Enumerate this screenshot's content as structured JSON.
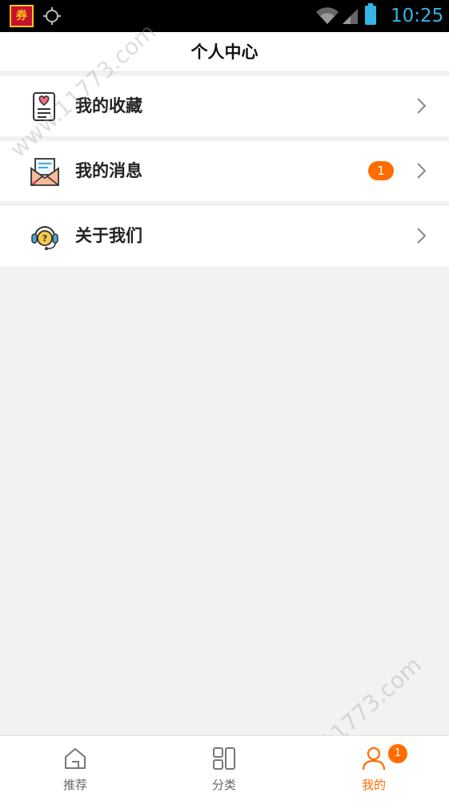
{
  "status_bar": {
    "app_icon_text": "券",
    "time": "10:25",
    "icons": [
      "app-notification-icon",
      "gps-icon",
      "wifi-icon",
      "signal-icon",
      "battery-icon"
    ]
  },
  "header": {
    "title": "个人中心"
  },
  "menu": {
    "items": [
      {
        "label": "我的收藏",
        "icon": "favorites-document-heart-icon"
      },
      {
        "label": "我的消息",
        "icon": "mail-envelope-icon",
        "badge": "1"
      },
      {
        "label": "关于我们",
        "icon": "headset-support-icon"
      }
    ]
  },
  "bottom_nav": {
    "tabs": [
      {
        "label": "推荐",
        "icon": "home-icon",
        "active": false
      },
      {
        "label": "分类",
        "icon": "category-grid-icon",
        "active": false
      },
      {
        "label": "我的",
        "icon": "user-icon",
        "active": true,
        "badge": "1"
      }
    ]
  },
  "watermark": {
    "text": "www.11773.com"
  },
  "colors": {
    "accent": "#ff6d00",
    "status_bar_bg": "#000000",
    "status_icon": "#33b5e5",
    "background": "#f2f2f2"
  }
}
